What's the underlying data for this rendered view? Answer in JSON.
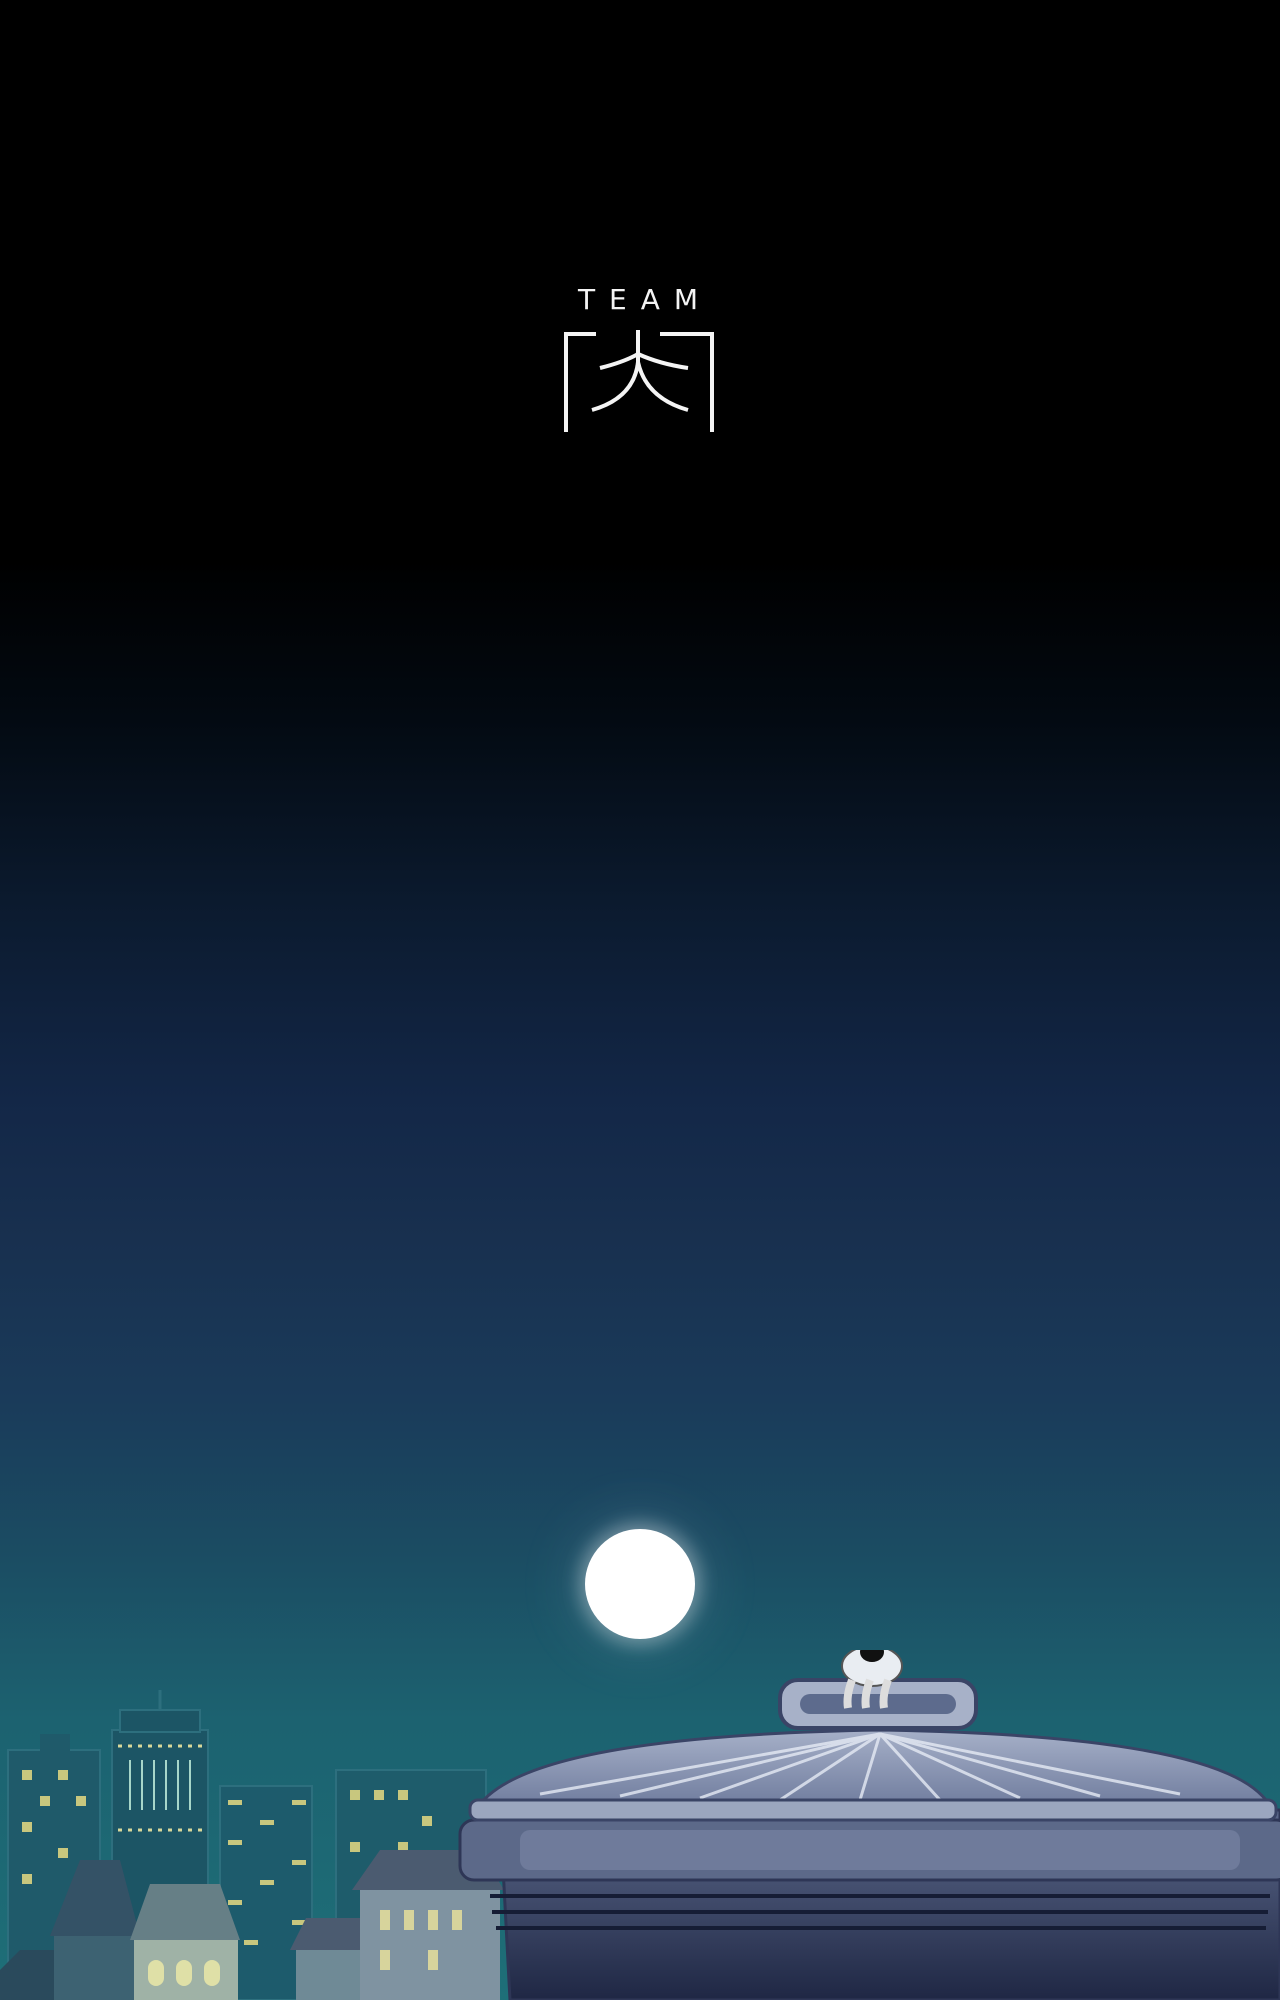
{
  "logo": {
    "word": "TEAM"
  },
  "colors": {
    "sky_top": "#000000",
    "sky_bottom": "#1e6f78",
    "moon": "#ffffff",
    "logo": "#f4f4f4",
    "lid": "#8e9bb8"
  }
}
